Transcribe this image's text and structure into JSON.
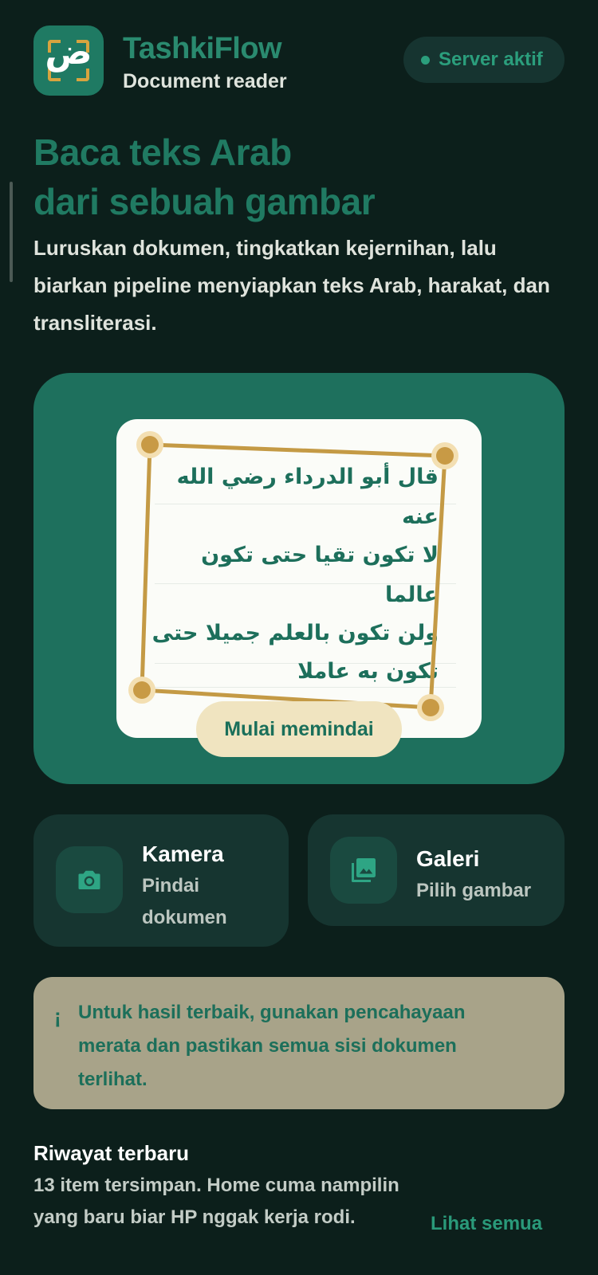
{
  "header": {
    "app_name": "TashkiFlow",
    "app_subtitle": "Document reader",
    "logo_glyph": "ض",
    "server_status": "Server aktif"
  },
  "hero": {
    "title_line1": "Baca teks Arab",
    "title_line2": "dari sebuah gambar",
    "description": "Luruskan dokumen, tingkatkan kejernihan, lalu biarkan pipeline menyiapkan teks Arab, harakat, dan transliterasi."
  },
  "scan_preview": {
    "lines": [
      "قال أبو الدرداء رضي الله عنه",
      "لا تكون تقيا حتى تكون عالما",
      "ولن تكون بالعلم جميلا حتى",
      "تكون به عاملا"
    ],
    "button_label": "Mulai memindai"
  },
  "sources": {
    "camera": {
      "title": "Kamera",
      "description": "Pindai dokumen",
      "icon": "camera-icon"
    },
    "gallery": {
      "title": "Galeri",
      "description": "Pilih gambar",
      "icon": "gallery-icon"
    }
  },
  "tip": {
    "icon": "¡",
    "text": "Untuk hasil terbaik, gunakan pencahayaan merata dan pastikan semua sisi dokumen terlihat."
  },
  "recent": {
    "title": "Riwayat terbaru",
    "description": "13 item tersimpan. Home cuma nampilin yang baru biar HP nggak kerja rodi.",
    "see_all_label": "Lihat semua"
  },
  "colors": {
    "background": "#0c1f1b",
    "accent": "#2a8a6f",
    "card": "#1e705d",
    "frame": "#c49a45",
    "tip_bg": "#a8a389"
  }
}
